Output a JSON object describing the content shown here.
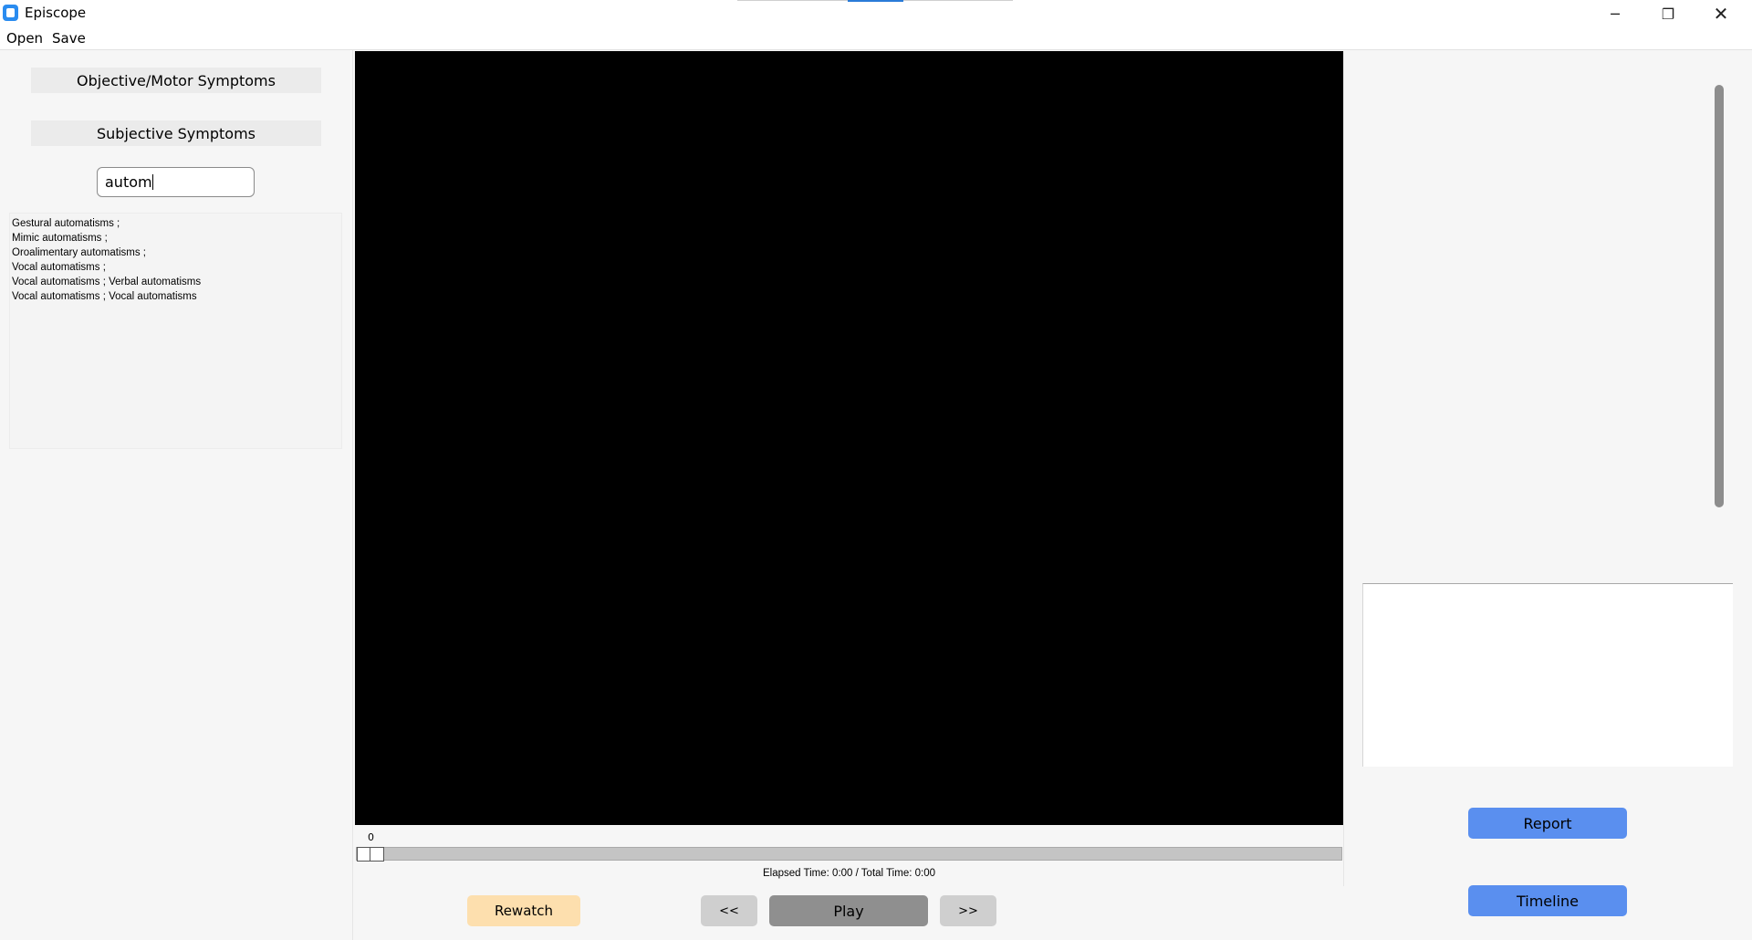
{
  "window": {
    "title": "Episcope",
    "controls": {
      "minimize": "─",
      "maximize": "❐",
      "close": "✕"
    }
  },
  "menu": {
    "open": "Open",
    "save": "Save"
  },
  "left_panel": {
    "objective_button": "Objective/Motor Symptoms",
    "subjective_button": "Subjective Symptoms",
    "search_value": "autom",
    "results": [
      "Gestural automatisms ;",
      "Mimic automatisms ;",
      "Oroalimentary automatisms  ;",
      "Vocal automatisms ;",
      "Vocal automatisms ; Verbal automatisms",
      "Vocal automatisms ; Vocal automatisms"
    ]
  },
  "player": {
    "position_label": "0",
    "seek_fraction": 0,
    "time_text": "Elapsed Time: 0:00 / Total Time: 0:00",
    "rewatch_label": "Rewatch",
    "prev_label": "<<",
    "play_label": "Play",
    "next_label": ">>"
  },
  "right_panel": {
    "report_label": "Report",
    "timeline_label": "Timeline"
  },
  "colors": {
    "accent_blue": "#5a8fef",
    "rewatch_bg": "#fddfae",
    "play_bg": "#8f8f8f",
    "video_bg": "#000000",
    "app_icon": "#2a8cf0"
  }
}
